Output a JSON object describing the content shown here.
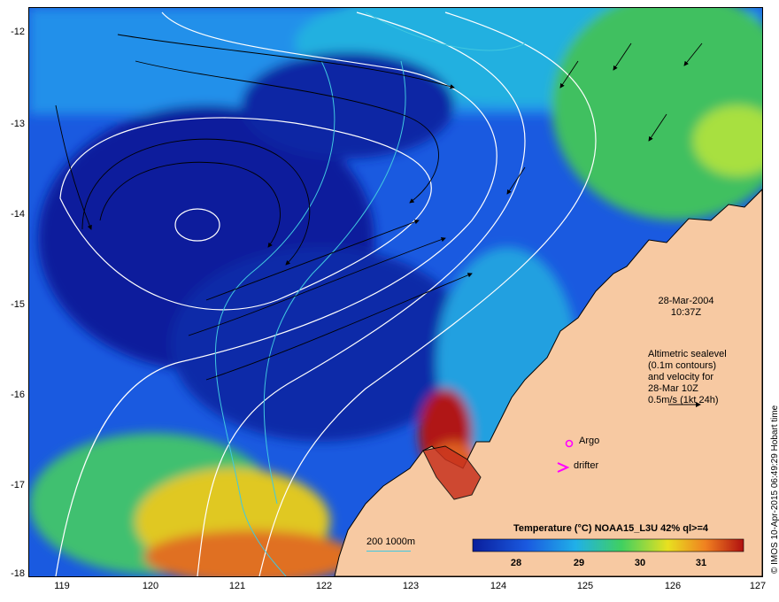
{
  "map": {
    "y_ticks": [
      "-12",
      "-13",
      "-14",
      "-15",
      "-16",
      "-17",
      "-18"
    ],
    "x_ticks": [
      "119",
      "120",
      "121",
      "122",
      "123",
      "124",
      "125",
      "126",
      "127"
    ],
    "lon_range": [
      118.6,
      127
    ],
    "lat_range": [
      -11.8,
      -18
    ]
  },
  "annotations": {
    "date": "28-Mar-2004",
    "time": "10:37Z",
    "altimetry_line1": "Altimetric sealevel",
    "altimetry_line2": "(0.1m contours)",
    "altimetry_line3": "and velocity for",
    "altimetry_line4": "28-Mar 10Z",
    "altimetry_line5": "0.5m/s (1kt 24h)",
    "argo_label": "Argo",
    "drifter_label": "drifter",
    "depth_legend": "200  1000m"
  },
  "colorbar": {
    "title": "Temperature (°C) NOAA15_L3U 42% ql>=4",
    "ticks": [
      "28",
      "29",
      "30",
      "31"
    ],
    "range": [
      27.3,
      31.8
    ]
  },
  "credit": "© IMOS 10-Apr-2015 06:49:29 Hobart time",
  "colors": {
    "land": "#f7c9a2",
    "deep_blue": "#0a1e9c",
    "mid_blue": "#1a5ae0",
    "cyan": "#20a8e8",
    "green": "#40d060",
    "yellow": "#e8e020",
    "orange": "#f08020",
    "red": "#b01010"
  }
}
